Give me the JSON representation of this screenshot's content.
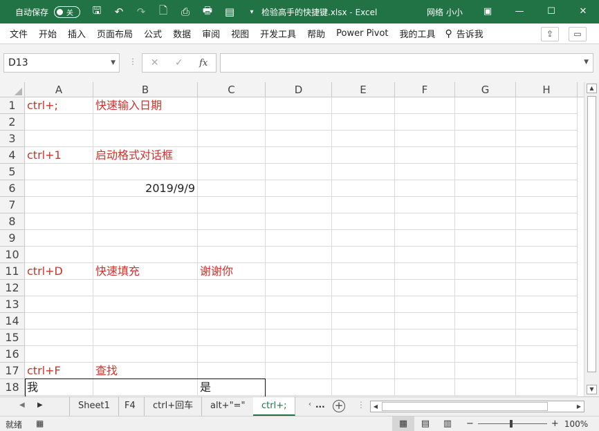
{
  "titlebar": {
    "autosave_label": "自动保存",
    "autosave_state": "关",
    "file_title": "检验高手的快捷键.xlsx  -  Excel",
    "user": "网络 小小",
    "icons": [
      "save-icon",
      "undo-icon",
      "redo-icon",
      "new-file-icon",
      "print-preview-icon",
      "quick-print-icon",
      "form-icon",
      "customize-qat-icon"
    ]
  },
  "menu": {
    "items": [
      "文件",
      "开始",
      "插入",
      "页面布局",
      "公式",
      "数据",
      "审阅",
      "视图",
      "开发工具",
      "帮助",
      "Power Pivot",
      "我的工具"
    ],
    "tell_me": "告诉我"
  },
  "formula_bar": {
    "name_box": "D13",
    "formula": ""
  },
  "sheet": {
    "columns": [
      "A",
      "B",
      "C",
      "D",
      "E",
      "F",
      "G",
      "H"
    ],
    "rows": [
      "1",
      "2",
      "3",
      "4",
      "5",
      "6",
      "7",
      "8",
      "9",
      "10",
      "11",
      "12",
      "13",
      "14",
      "15",
      "16",
      "17",
      "18"
    ],
    "cells": {
      "A1": "ctrl+;",
      "B1": "快速输入日期",
      "A4": "ctrl+1",
      "B4": "启动格式对话框",
      "B6": "2019/9/9",
      "A11": "ctrl+D",
      "B11": "快速填充",
      "C11": "谢谢你",
      "A17": "ctrl+F",
      "B17": "查找",
      "A18": "我",
      "C18": "是"
    },
    "colors": {
      "shortcut_text": "#d0312d",
      "header_bg": "#f3f3f3",
      "accent": "#217346"
    }
  },
  "tabs": {
    "items": [
      "Sheet1",
      "F4",
      "ctrl+回车",
      "alt+\"=\"",
      "ctrl+;"
    ],
    "active": "ctrl+;",
    "more": "..."
  },
  "status": {
    "ready": "就绪",
    "zoom": "100%"
  }
}
